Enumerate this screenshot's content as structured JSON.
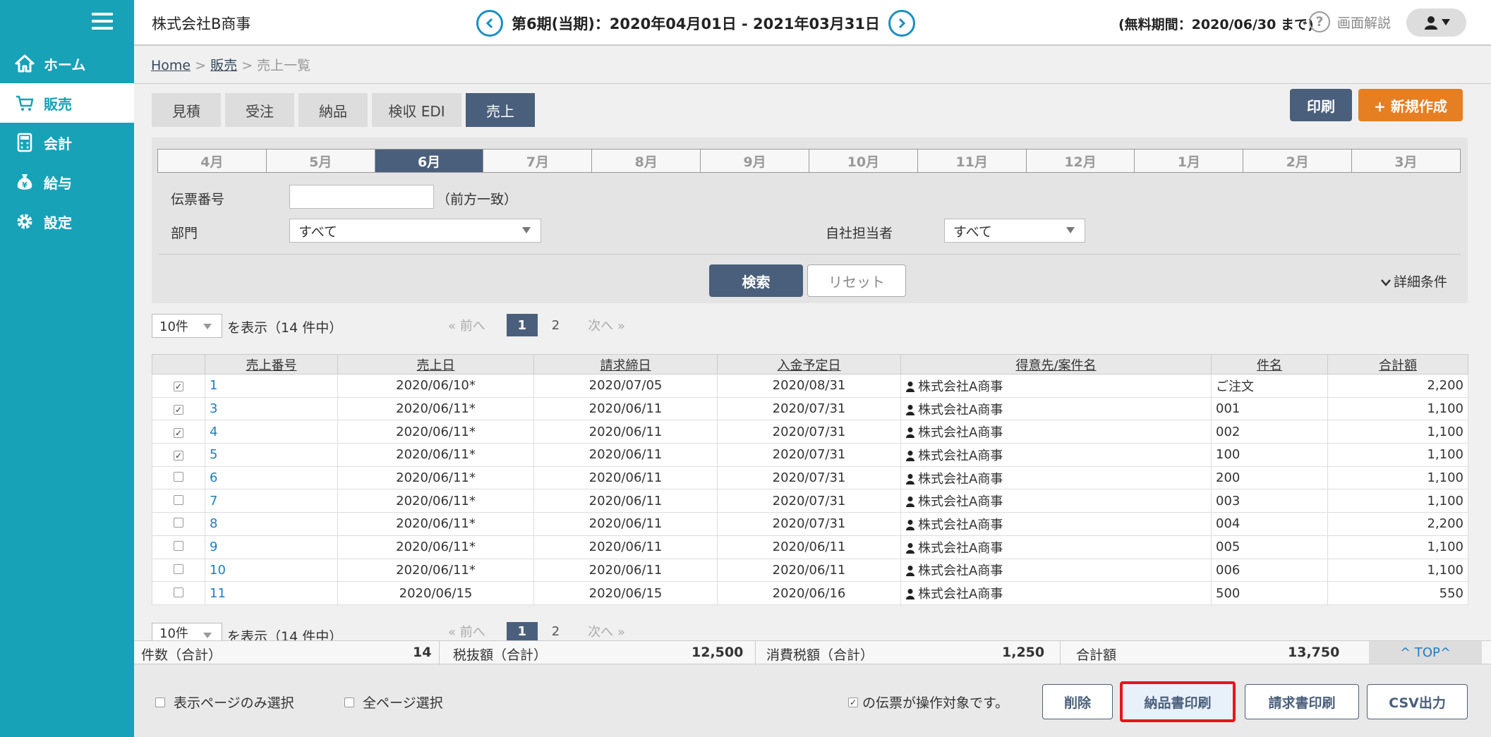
{
  "sidebar": {
    "items": [
      {
        "label": "ホーム",
        "icon": "home-icon"
      },
      {
        "label": "販売",
        "icon": "cart-icon"
      },
      {
        "label": "会計",
        "icon": "calculator-icon"
      },
      {
        "label": "給与",
        "icon": "money-bag-icon"
      },
      {
        "label": "設定",
        "icon": "gear-icon"
      }
    ],
    "active": "販売"
  },
  "header": {
    "company": "株式会社B商事",
    "period": "第6期(当期)：2020年04月01日 - 2021年03月31日",
    "free_period": "(無料期間：2020/06/30 まで)",
    "help_label": "画面解説"
  },
  "breadcrumb": {
    "home": "Home",
    "sales": "販売",
    "current": "売上一覧",
    "sep1": ">",
    "sep2": ">"
  },
  "tabs": [
    "見積",
    "受注",
    "納品",
    "検収 EDI",
    "売上"
  ],
  "actions": {
    "print": "印刷",
    "new": "+ 新規作成"
  },
  "months": [
    "4月",
    "5月",
    "6月",
    "7月",
    "8月",
    "9月",
    "10月",
    "11月",
    "12月",
    "1月",
    "2月",
    "3月"
  ],
  "active_month": "6月",
  "filters": {
    "voucher_label": "伝票番号",
    "voucher_value": "",
    "voucher_hint": "（前方一致）",
    "dept_label": "部門",
    "dept_value": "すべて",
    "staff_label": "自社担当者",
    "staff_value": "すべて"
  },
  "buttons": {
    "search": "検索",
    "reset": "リセット",
    "detail": "詳細条件"
  },
  "pagination": {
    "per_page": "10件",
    "display_text": "を表示（14 件中）",
    "prev": "« 前へ",
    "next": "次へ »",
    "pages": [
      "1",
      "2"
    ],
    "current": "1"
  },
  "table": {
    "columns": [
      "売上番号",
      "売上日",
      "請求締日",
      "入金予定日",
      "得意先/案件名",
      "件名",
      "合計額"
    ],
    "rows": [
      {
        "checked": true,
        "no": "1",
        "date": "2020/06/10*",
        "close": "2020/07/05",
        "pay": "2020/08/31",
        "client": "株式会社A商事",
        "subject": "ご注文",
        "total": "2,200"
      },
      {
        "checked": true,
        "no": "3",
        "date": "2020/06/11*",
        "close": "2020/06/11",
        "pay": "2020/07/31",
        "client": "株式会社A商事",
        "subject": "001",
        "total": "1,100"
      },
      {
        "checked": true,
        "no": "4",
        "date": "2020/06/11*",
        "close": "2020/06/11",
        "pay": "2020/07/31",
        "client": "株式会社A商事",
        "subject": "002",
        "total": "1,100"
      },
      {
        "checked": true,
        "no": "5",
        "date": "2020/06/11*",
        "close": "2020/06/11",
        "pay": "2020/07/31",
        "client": "株式会社A商事",
        "subject": "100",
        "total": "1,100"
      },
      {
        "checked": false,
        "no": "6",
        "date": "2020/06/11*",
        "close": "2020/06/11",
        "pay": "2020/07/31",
        "client": "株式会社A商事",
        "subject": "200",
        "total": "1,100"
      },
      {
        "checked": false,
        "no": "7",
        "date": "2020/06/11*",
        "close": "2020/06/11",
        "pay": "2020/07/31",
        "client": "株式会社A商事",
        "subject": "003",
        "total": "1,100"
      },
      {
        "checked": false,
        "no": "8",
        "date": "2020/06/11*",
        "close": "2020/06/11",
        "pay": "2020/07/31",
        "client": "株式会社A商事",
        "subject": "004",
        "total": "2,200"
      },
      {
        "checked": false,
        "no": "9",
        "date": "2020/06/11*",
        "close": "2020/06/11",
        "pay": "2020/06/11",
        "client": "株式会社A商事",
        "subject": "005",
        "total": "1,100"
      },
      {
        "checked": false,
        "no": "10",
        "date": "2020/06/11*",
        "close": "2020/06/11",
        "pay": "2020/06/11",
        "client": "株式会社A商事",
        "subject": "006",
        "total": "1,100"
      },
      {
        "checked": false,
        "no": "11",
        "date": "2020/06/15",
        "close": "2020/06/15",
        "pay": "2020/06/16",
        "client": "株式会社A商事",
        "subject": "500",
        "total": "550"
      }
    ]
  },
  "summary": {
    "count_label": "件数（合計）",
    "count": "14",
    "pretax_label": "税抜額（合計）",
    "pretax": "12,500",
    "tax_label": "消費税額（合計）",
    "tax": "1,250",
    "total_label": "合計額",
    "total": "13,750",
    "top": "^ TOP^"
  },
  "footer": {
    "select_page": "表示ページのみ選択",
    "select_all": "全ページ選択",
    "target_text": "の伝票が操作対象です。",
    "delete": "削除",
    "delivery_print": "納品書印刷",
    "invoice_print": "請求書印刷",
    "csv": "CSV出力"
  },
  "colors": {
    "sidebar": "#17a2b8",
    "primary": "#4a5f7c",
    "accent": "#e67e22",
    "highlight": "#e8141c"
  }
}
